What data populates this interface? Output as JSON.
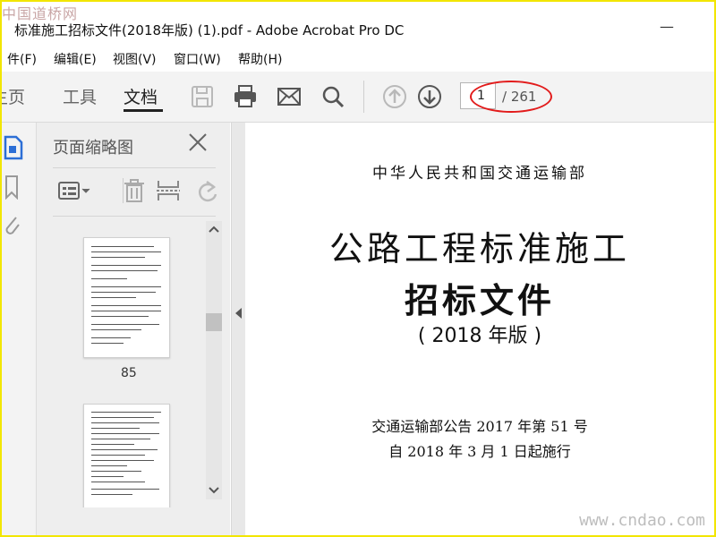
{
  "watermarks": {
    "top": "中国道桥网",
    "bottom": "www.cndao.com"
  },
  "window": {
    "title": "标准施工招标文件(2018年版) (1).pdf - Adobe Acrobat Pro DC",
    "minimize": "—"
  },
  "menu": {
    "items": [
      "件(F)",
      "编辑(E)",
      "视图(V)",
      "窗口(W)",
      "帮助(H)"
    ]
  },
  "toolbar": {
    "tabs": [
      "主页",
      "工具",
      "文档"
    ],
    "page_current": "1",
    "page_total": "/ 261"
  },
  "panel": {
    "title": "页面缩略图",
    "thumbnails": [
      {
        "label": "85"
      }
    ]
  },
  "document": {
    "ministry": "中华人民共和国交通运输部",
    "title_line1": "公路工程标准施工",
    "title_line2": "招标文件",
    "edition": "( 2018 年版 )",
    "notice_line1": "交通运输部公告 2017 年第 51 号",
    "notice_line2": "自 2018 年 3 月 1 日起施行"
  },
  "colors": {
    "accent": "#2d6fd6",
    "annotation": "#e21b1b",
    "frame": "#f2e600"
  }
}
